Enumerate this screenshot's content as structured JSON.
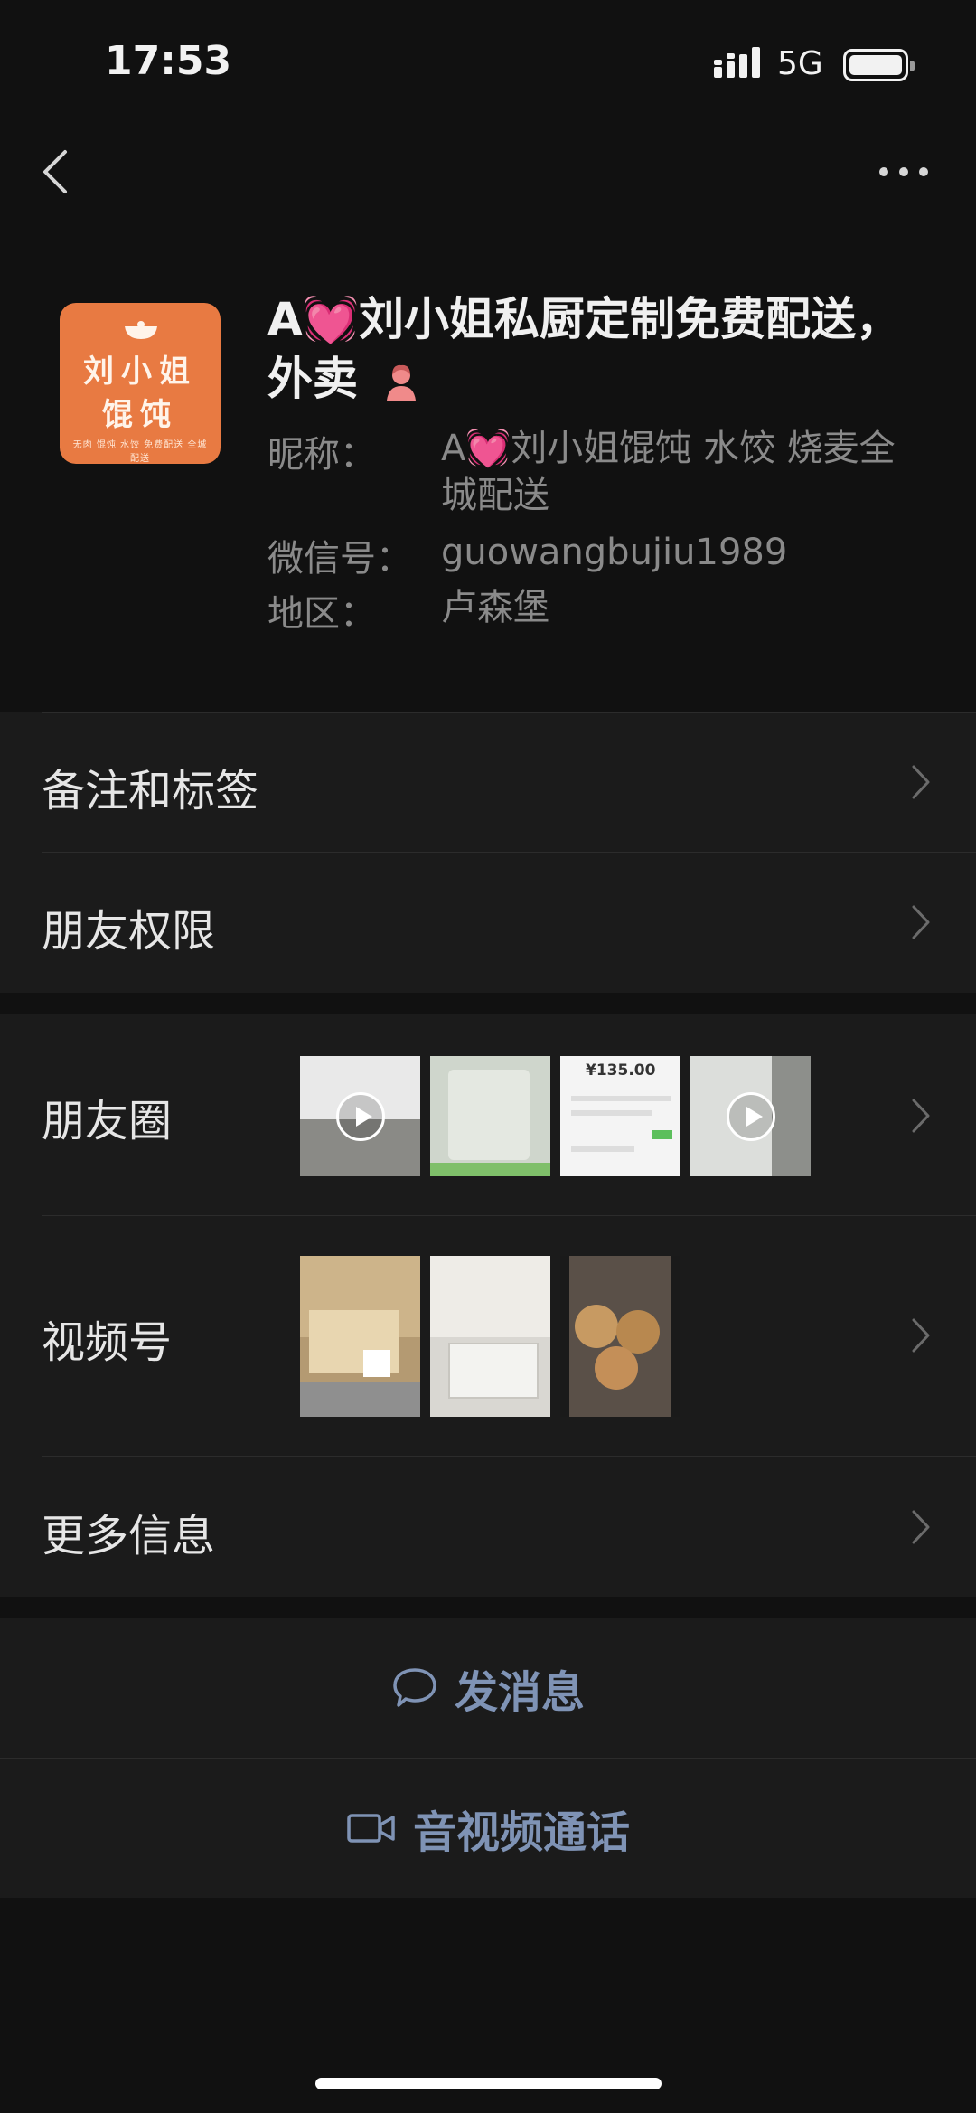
{
  "status_bar": {
    "time": "17:53",
    "network": "5G"
  },
  "avatar": {
    "line1": "刘小姐",
    "line2": "馄饨",
    "tagline": "无肉 馄饨 水饺 免费配送 全城 配送"
  },
  "profile": {
    "name_prefix": "A",
    "name_emoji": "💓",
    "name_text": "刘小姐私厨定制免费配送，外卖",
    "nickname_label": "昵称：",
    "nickname_prefix": "A",
    "nickname_emoji": "💓",
    "nickname_text": "刘小姐馄饨 水饺 烧麦全城配送",
    "wechat_label": "微信号：",
    "wechat_id": "guowangbujiu1989",
    "region_label": "地区：",
    "region": "卢森堡"
  },
  "menu": {
    "remarks": "备注和标签",
    "permissions": "朋友权限",
    "moments": "朋友圈",
    "channels": "视频号",
    "more_info": "更多信息"
  },
  "moments_thumbs": [
    {
      "kind": "video",
      "color": "#bdbdbd"
    },
    {
      "kind": "image",
      "color": "#cfd6cc"
    },
    {
      "kind": "image",
      "color": "#f4f4f4",
      "price": "¥135.00"
    },
    {
      "kind": "video",
      "color": "#c7c9c5"
    }
  ],
  "channel_thumbs": [
    {
      "color": "#b49a72"
    },
    {
      "color": "#d9d7d2"
    },
    {
      "color": "#5a5048"
    }
  ],
  "actions": {
    "message": "发消息",
    "call": "音视频通话"
  }
}
